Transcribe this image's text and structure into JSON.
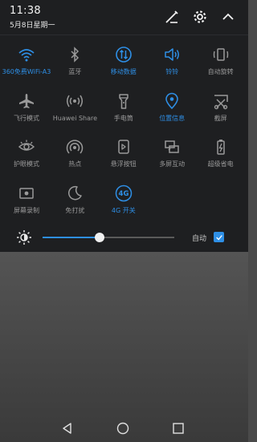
{
  "status": {
    "time": "11:38",
    "date": "5月8日星期一"
  },
  "header_icons": [
    "edit-icon",
    "gear-icon",
    "chevron-up-icon"
  ],
  "accent": "#2e8fe6",
  "tiles": [
    {
      "label": "360免费WiFi-A3",
      "icon": "wifi-icon",
      "on": true
    },
    {
      "label": "蓝牙",
      "icon": "bluetooth-icon",
      "on": false
    },
    {
      "label": "移动数据",
      "icon": "mobile-data-icon",
      "on": true
    },
    {
      "label": "铃铃",
      "icon": "sound-icon",
      "on": true
    },
    {
      "label": "自动旋转",
      "icon": "rotate-icon",
      "on": false
    },
    {
      "label": "飞行模式",
      "icon": "airplane-icon",
      "on": false
    },
    {
      "label": "Huawei Share",
      "icon": "share-icon",
      "on": false
    },
    {
      "label": "手电筒",
      "icon": "flashlight-icon",
      "on": false
    },
    {
      "label": "位置信息",
      "icon": "location-icon",
      "on": true
    },
    {
      "label": "截屏",
      "icon": "screenshot-icon",
      "on": false
    },
    {
      "label": "护眼模式",
      "icon": "eye-icon",
      "on": false
    },
    {
      "label": "热点",
      "icon": "hotspot-icon",
      "on": false
    },
    {
      "label": "悬浮按钮",
      "icon": "floating-button-icon",
      "on": false
    },
    {
      "label": "多屏互动",
      "icon": "multiscreen-icon",
      "on": false
    },
    {
      "label": "超级省电",
      "icon": "battery-saver-icon",
      "on": false
    },
    {
      "label": "屏幕录制",
      "icon": "screen-record-icon",
      "on": false
    },
    {
      "label": "免打扰",
      "icon": "moon-icon",
      "on": false
    },
    {
      "label": "4G 开关",
      "icon": "4g-icon",
      "on": true
    }
  ],
  "brightness": {
    "level": 0.43,
    "auto_label": "自动",
    "auto_checked": true
  },
  "nav": [
    "back-icon",
    "home-icon",
    "recents-icon"
  ]
}
